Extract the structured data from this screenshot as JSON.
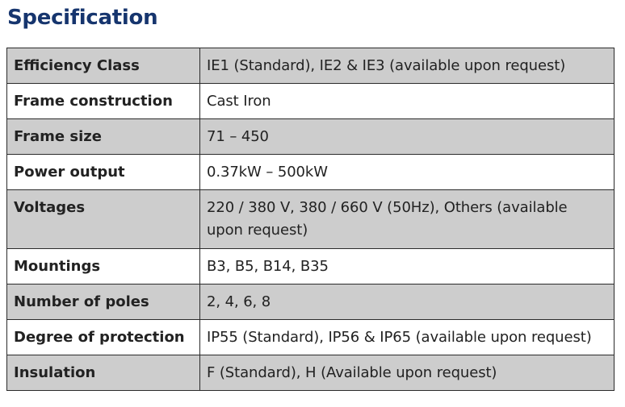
{
  "heading": "Specification",
  "rows": [
    {
      "label": "Efficiency Class",
      "value": "IE1 (Standard), IE2 & IE3 (available upon request)"
    },
    {
      "label": "Frame construction",
      "value": "Cast Iron"
    },
    {
      "label": "Frame size",
      "value": "71 – 450"
    },
    {
      "label": "Power output",
      "value": "0.37kW – 500kW"
    },
    {
      "label": "Voltages",
      "value": "220 / 380 V, 380 / 660 V (50Hz), Others (available upon request)"
    },
    {
      "label": "Mountings",
      "value": "B3, B5, B14, B35"
    },
    {
      "label": "Number of poles",
      "value": "2, 4, 6, 8"
    },
    {
      "label": "Degree of protection",
      "value": "IP55 (Standard), IP56 & IP65 (available upon request)"
    },
    {
      "label": "Insulation",
      "value": "F (Standard), H (Available upon request)"
    }
  ]
}
